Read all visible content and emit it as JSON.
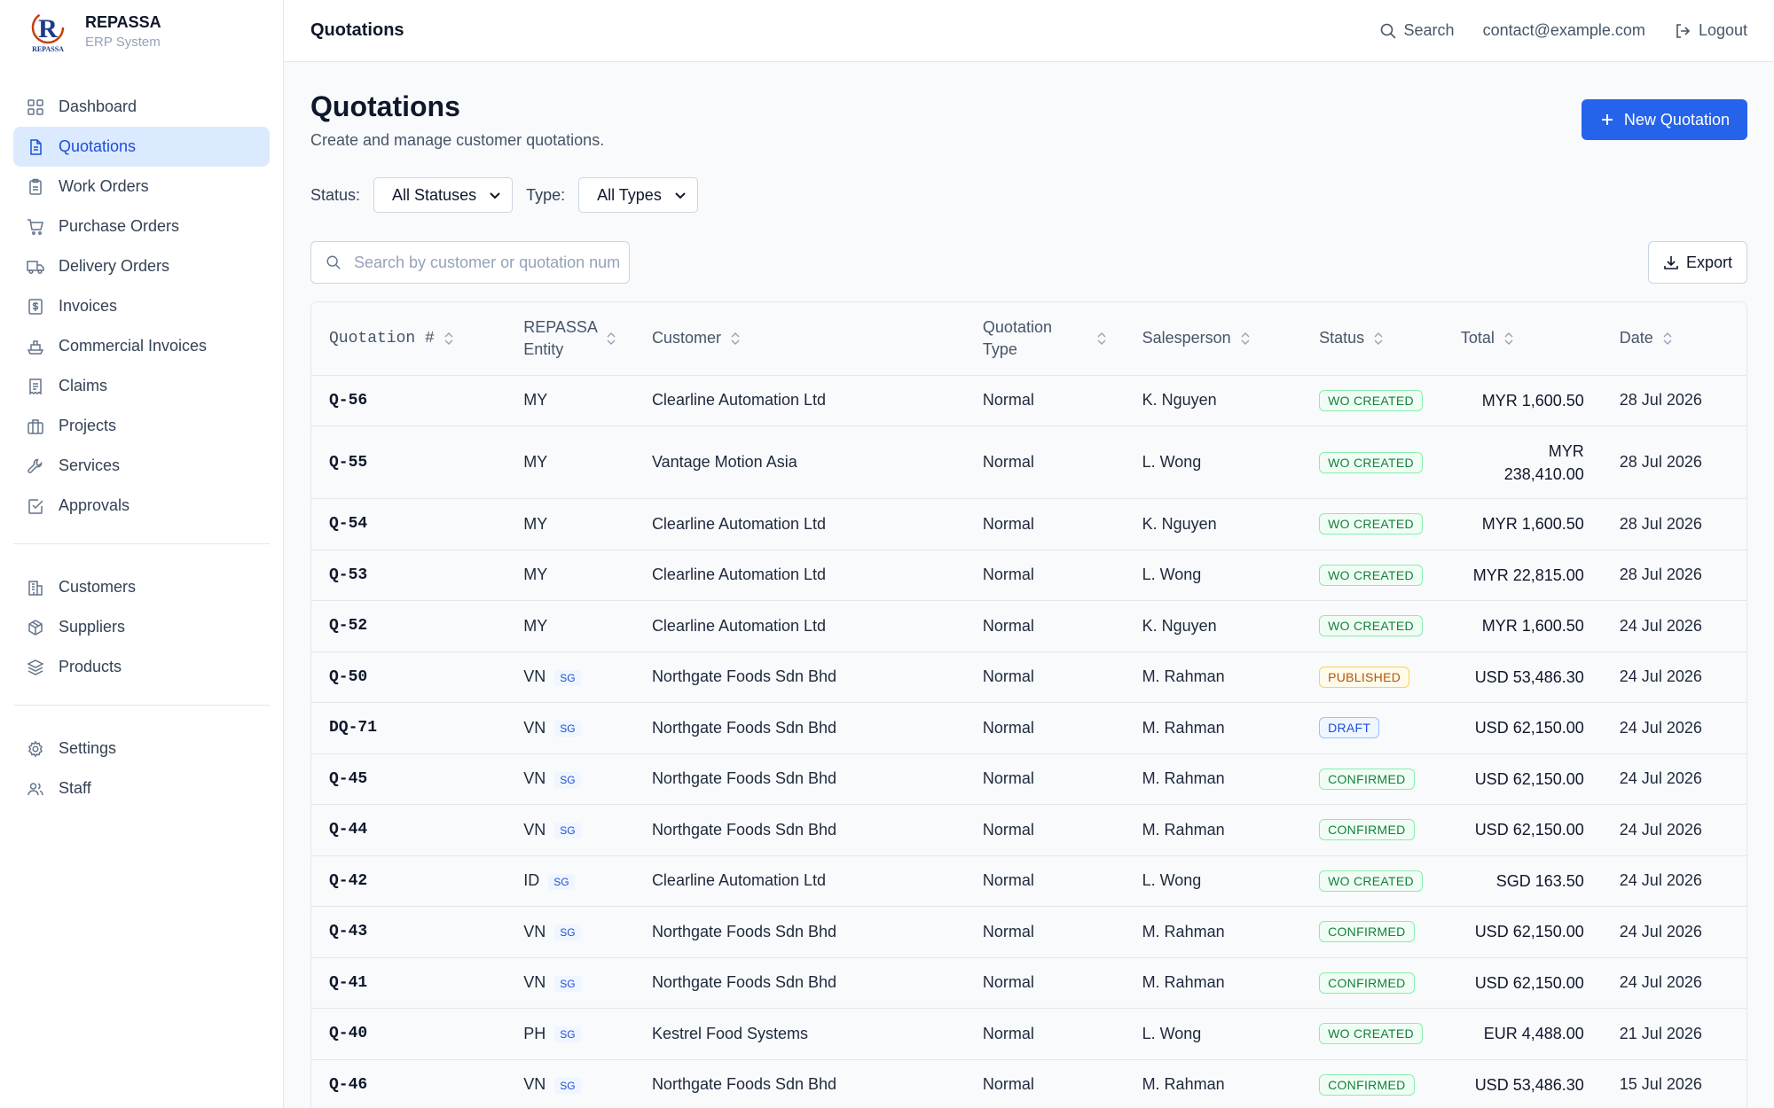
{
  "brand": {
    "name": "REPASSA",
    "subtitle": "ERP System",
    "logo_text": "R",
    "logo_caption": "REPASSA"
  },
  "sidebar": {
    "items": [
      {
        "label": "Dashboard",
        "icon": "grid-icon"
      },
      {
        "label": "Quotations",
        "icon": "document-icon",
        "active": true
      },
      {
        "label": "Work Orders",
        "icon": "clipboard-icon"
      },
      {
        "label": "Purchase Orders",
        "icon": "cart-icon"
      },
      {
        "label": "Delivery Orders",
        "icon": "truck-icon"
      },
      {
        "label": "Invoices",
        "icon": "invoice-icon"
      },
      {
        "label": "Commercial Invoices",
        "icon": "ship-icon"
      },
      {
        "label": "Claims",
        "icon": "receipt-icon"
      },
      {
        "label": "Projects",
        "icon": "briefcase-icon"
      },
      {
        "label": "Services",
        "icon": "wrench-icon"
      },
      {
        "label": "Approvals",
        "icon": "check-square-icon"
      }
    ],
    "items2": [
      {
        "label": "Customers",
        "icon": "building-icon"
      },
      {
        "label": "Suppliers",
        "icon": "package-icon"
      },
      {
        "label": "Products",
        "icon": "layers-icon"
      }
    ],
    "items3": [
      {
        "label": "Settings",
        "icon": "gear-icon"
      },
      {
        "label": "Staff",
        "icon": "users-icon"
      }
    ]
  },
  "topbar": {
    "title": "Quotations",
    "search_label": "Search",
    "email": "contact@example.com",
    "logout_label": "Logout"
  },
  "page": {
    "title": "Quotations",
    "subtitle": "Create and manage customer quotations.",
    "new_button": "New Quotation",
    "status_label": "Status:",
    "status_value": "All Statuses",
    "type_label": "Type:",
    "type_value": "All Types",
    "search_placeholder": "Search by customer or quotation number",
    "export_label": "Export"
  },
  "table": {
    "headers": [
      "Quotation #",
      "REPASSA Entity",
      "Customer",
      "Quotation Type",
      "Salesperson",
      "Status",
      "Total",
      "Date"
    ],
    "rows": [
      {
        "num": "Q-56",
        "entity": "MY",
        "sg": "",
        "customer": "Clearline Automation Ltd",
        "type": "Normal",
        "sales": "K. Nguyen",
        "status": "WO CREATED",
        "total": "MYR 1,600.50",
        "date": "28 Jul 2026"
      },
      {
        "num": "Q-55",
        "entity": "MY",
        "sg": "",
        "customer": "Vantage Motion Asia",
        "type": "Normal",
        "sales": "L. Wong",
        "status": "WO CREATED",
        "total": "MYR 238,410.00",
        "date": "28 Jul 2026"
      },
      {
        "num": "Q-54",
        "entity": "MY",
        "sg": "",
        "customer": "Clearline Automation Ltd",
        "type": "Normal",
        "sales": "K. Nguyen",
        "status": "WO CREATED",
        "total": "MYR 1,600.50",
        "date": "28 Jul 2026"
      },
      {
        "num": "Q-53",
        "entity": "MY",
        "sg": "",
        "customer": "Clearline Automation Ltd",
        "type": "Normal",
        "sales": "L. Wong",
        "status": "WO CREATED",
        "total": "MYR 22,815.00",
        "date": "28 Jul 2026"
      },
      {
        "num": "Q-52",
        "entity": "MY",
        "sg": "",
        "customer": "Clearline Automation Ltd",
        "type": "Normal",
        "sales": "K. Nguyen",
        "status": "WO CREATED",
        "total": "MYR 1,600.50",
        "date": "24 Jul 2026"
      },
      {
        "num": "Q-50",
        "entity": "VN",
        "sg": "SG",
        "customer": "Northgate Foods Sdn Bhd",
        "type": "Normal",
        "sales": "M. Rahman",
        "status": "PUBLISHED",
        "total": "USD 53,486.30",
        "date": "24 Jul 2026"
      },
      {
        "num": "DQ-71",
        "entity": "VN",
        "sg": "SG",
        "customer": "Northgate Foods Sdn Bhd",
        "type": "Normal",
        "sales": "M. Rahman",
        "status": "DRAFT",
        "total": "USD 62,150.00",
        "date": "24 Jul 2026"
      },
      {
        "num": "Q-45",
        "entity": "VN",
        "sg": "SG",
        "customer": "Northgate Foods Sdn Bhd",
        "type": "Normal",
        "sales": "M. Rahman",
        "status": "CONFIRMED",
        "total": "USD 62,150.00",
        "date": "24 Jul 2026"
      },
      {
        "num": "Q-44",
        "entity": "VN",
        "sg": "SG",
        "customer": "Northgate Foods Sdn Bhd",
        "type": "Normal",
        "sales": "M. Rahman",
        "status": "CONFIRMED",
        "total": "USD 62,150.00",
        "date": "24 Jul 2026"
      },
      {
        "num": "Q-42",
        "entity": "ID",
        "sg": "SG",
        "customer": "Clearline Automation Ltd",
        "type": "Normal",
        "sales": "L. Wong",
        "status": "WO CREATED",
        "total": "SGD 163.50",
        "date": "24 Jul 2026"
      },
      {
        "num": "Q-43",
        "entity": "VN",
        "sg": "SG",
        "customer": "Northgate Foods Sdn Bhd",
        "type": "Normal",
        "sales": "M. Rahman",
        "status": "CONFIRMED",
        "total": "USD 62,150.00",
        "date": "24 Jul 2026"
      },
      {
        "num": "Q-41",
        "entity": "VN",
        "sg": "SG",
        "customer": "Northgate Foods Sdn Bhd",
        "type": "Normal",
        "sales": "M. Rahman",
        "status": "CONFIRMED",
        "total": "USD 62,150.00",
        "date": "24 Jul 2026"
      },
      {
        "num": "Q-40",
        "entity": "PH",
        "sg": "SG",
        "customer": "Kestrel Food Systems",
        "type": "Normal",
        "sales": "L. Wong",
        "status": "WO CREATED",
        "total": "EUR 4,488.00",
        "date": "21 Jul 2026"
      },
      {
        "num": "Q-46",
        "entity": "VN",
        "sg": "SG",
        "customer": "Northgate Foods Sdn Bhd",
        "type": "Normal",
        "sales": "M. Rahman",
        "status": "CONFIRMED",
        "total": "USD 53,486.30",
        "date": "15 Jul 2026"
      }
    ]
  },
  "colors": {
    "accent": "#2563eb",
    "active_bg": "#dbeafe",
    "status_green": "#15803d",
    "status_amber": "#b45309",
    "status_blue": "#1d4ed8"
  }
}
